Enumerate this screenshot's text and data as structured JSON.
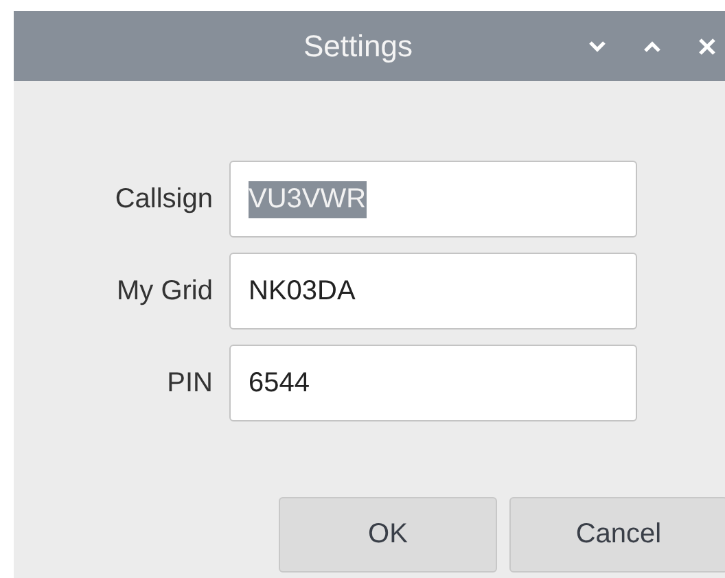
{
  "window": {
    "title": "Settings",
    "controls": [
      {
        "kind": "minimize"
      },
      {
        "kind": "maximize"
      },
      {
        "kind": "close"
      }
    ]
  },
  "fields": [
    {
      "label": "Callsign",
      "value": "VU3VWR",
      "selected": true
    },
    {
      "label": "My Grid",
      "value": "NK03DA",
      "selected": false
    },
    {
      "label": "PIN",
      "value": "6544",
      "selected": false
    }
  ],
  "buttons": [
    "OK",
    "Cancel"
  ]
}
